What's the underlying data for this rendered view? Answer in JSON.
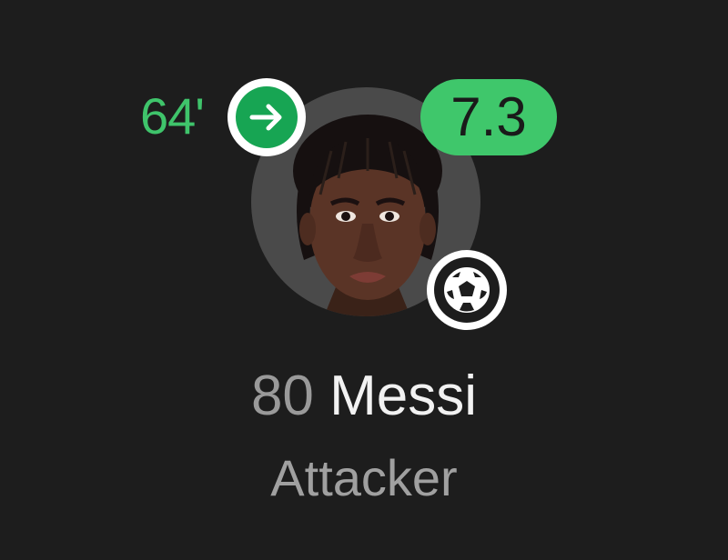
{
  "player": {
    "sub_minute": "64'",
    "rating": "7.3",
    "shirt_number": "80",
    "name": "Messi",
    "position": "Attacker"
  },
  "icons": {
    "substitution": "arrow-right-icon",
    "event": "soccer-ball-icon"
  },
  "colors": {
    "background": "#1d1d1d",
    "accent_green": "#3fc46b",
    "sub_badge_green": "#17a553",
    "rating_badge": "#3fc76b",
    "avatar_bg": "#4a4a4a",
    "name_text": "#f2f2f2",
    "muted_text": "#9a9a9a"
  }
}
